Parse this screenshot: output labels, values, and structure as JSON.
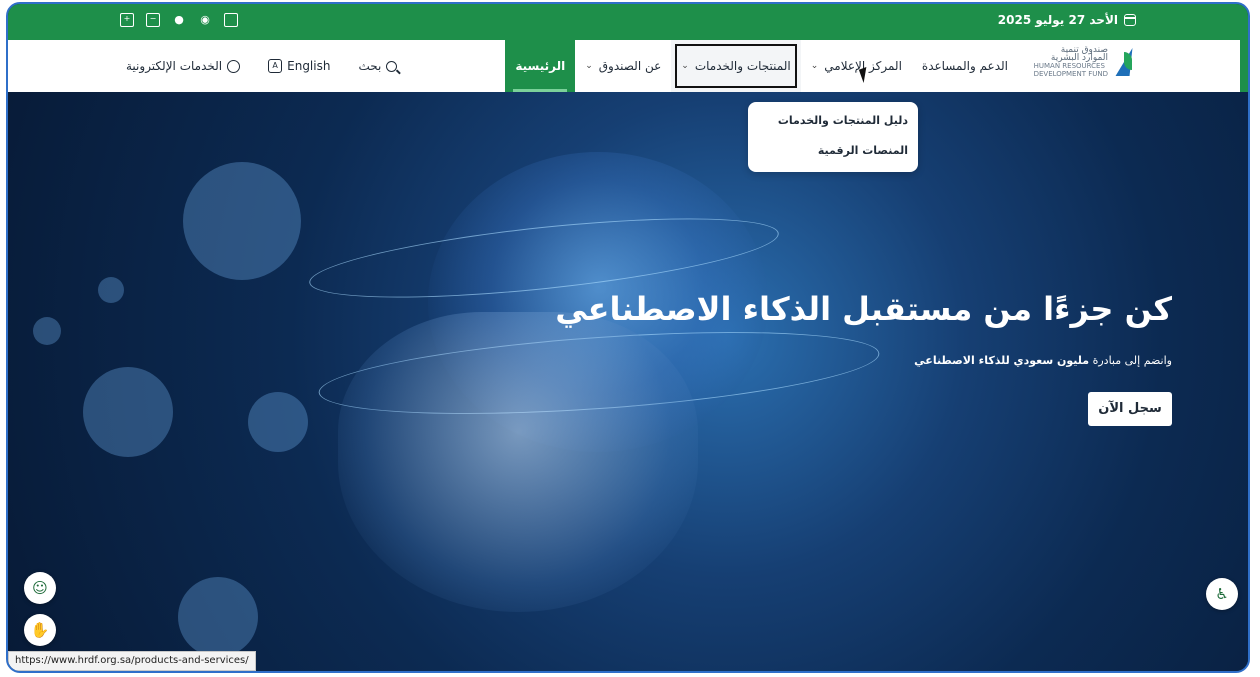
{
  "topbar": {
    "date": "الأحد 27 يوليو 2025",
    "tools": [
      "zoom-in-icon",
      "zoom-out-icon",
      "mic-icon",
      "eye-icon",
      "clipboard-icon"
    ]
  },
  "logo": {
    "ar_line1": "صندوق تنمية",
    "ar_line2": "الموارد البشرية",
    "en_line1": "HUMAN RESOURCES",
    "en_line2": "DEVELOPMENT FUND"
  },
  "nav": {
    "items": [
      {
        "label": "الرئيسية",
        "active": true,
        "dropdown": false
      },
      {
        "label": "عن الصندوق",
        "active": false,
        "dropdown": true
      },
      {
        "label": "المنتجات والخدمات",
        "active": false,
        "dropdown": true
      },
      {
        "label": "المركز الإعلامي",
        "active": false,
        "dropdown": true
      },
      {
        "label": "الدعم والمساعدة",
        "active": false,
        "dropdown": false
      }
    ],
    "search_label": "بحث",
    "language_label": "English",
    "eservices_label": "الخدمات الإلكترونية"
  },
  "dropdown": {
    "items": [
      "دليل المنتجات والخدمات",
      "المنصات الرقمية"
    ]
  },
  "hero": {
    "headline": "كن جزءًا من مستقبل الذكاء الاصطناعي",
    "subtitle_pre": "وانضم إلى مبادرة ",
    "subtitle_bold": "مليون سعودي للذكاء الاصطناعي",
    "cta_label": "سجل الآن"
  },
  "status_url": "https://www.hrdf.org.sa/products-and-services/"
}
